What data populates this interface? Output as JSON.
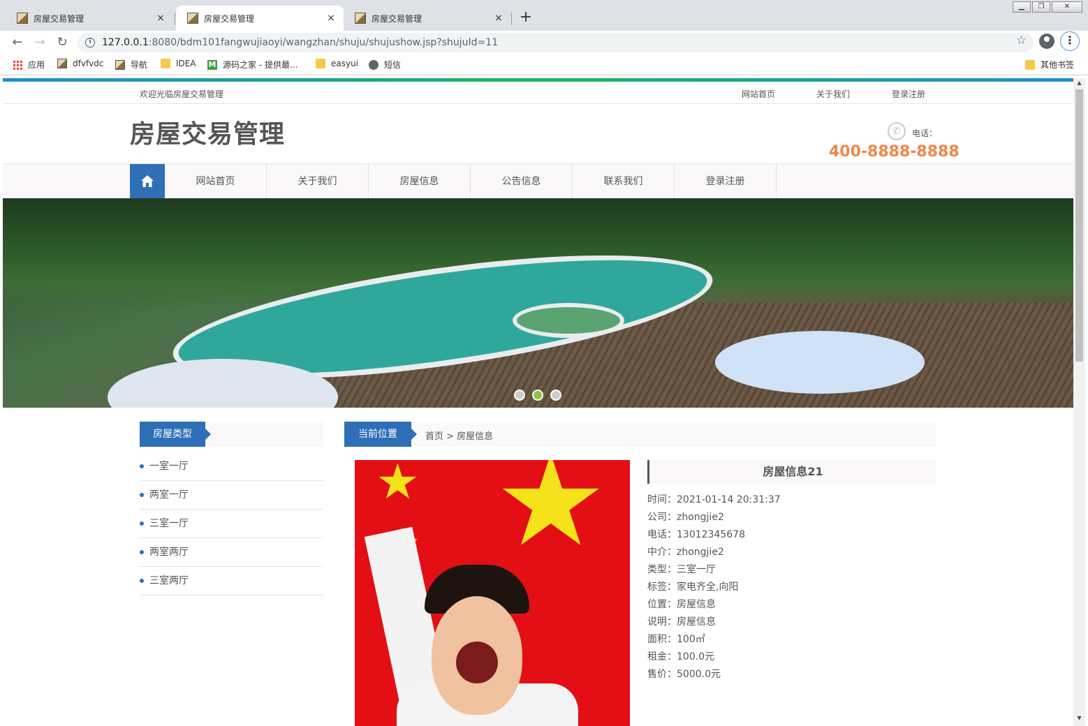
{
  "browser": {
    "tabs": [
      {
        "title": "房屋交易管理",
        "close": "×"
      },
      {
        "title": "房屋交易管理",
        "close": "×"
      },
      {
        "title": "房屋交易管理",
        "close": "×"
      }
    ],
    "new_tab": "+",
    "url_host": "127.0.0.1",
    "url_rest": ":8080/bdm101fangwujiaoyi/wangzhan/shuju/shujushow.jsp?shujuId=11",
    "bookmarks": [
      "应用",
      "dfvfvdc",
      "导航",
      "IDEA",
      "源码之家 - 提供最...",
      "easyui",
      "短信"
    ],
    "other_bookmarks": "其他书签"
  },
  "site": {
    "welcome": "欢迎光临房屋交易管理",
    "top_links": [
      "网站首页",
      "关于我们",
      "登录注册"
    ],
    "logo": "房屋交易管理",
    "phone_label": "电话：",
    "phone_number": "400-8888-8888",
    "nav": [
      "网站首页",
      "关于我们",
      "房屋信息",
      "公告信息",
      "联系我们",
      "登录注册"
    ],
    "banner_active_dot": 2
  },
  "sidebar": {
    "title": "房屋类型",
    "items": [
      "一室一厅",
      "两室一厅",
      "三室一厅",
      "两室两厅",
      "三室两厅"
    ]
  },
  "breadcrumb": {
    "label": "当前位置",
    "path": "首页 > 房屋信息"
  },
  "detail": {
    "title": "房屋信息21",
    "rows": [
      "时间：2021-01-14 20:31:37",
      "公司：zhongjie2",
      "电话：13012345678",
      "中介：zhongjie2",
      "类型：三室一厅",
      "标签：家电齐全,向阳",
      "位置：房屋信息",
      "说明：房屋信息",
      "面积：100㎡",
      "租金：100.0元",
      "售价：5000.0元"
    ]
  }
}
